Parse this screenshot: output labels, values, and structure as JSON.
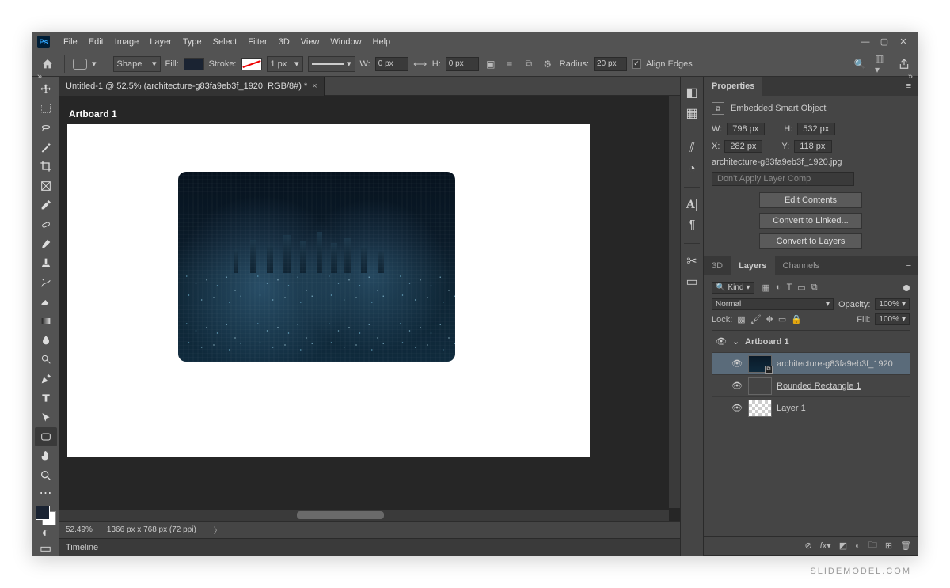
{
  "app": {
    "logo": "Ps"
  },
  "menu": [
    "File",
    "Edit",
    "Image",
    "Layer",
    "Type",
    "Select",
    "Filter",
    "3D",
    "View",
    "Window",
    "Help"
  ],
  "options": {
    "mode": "Shape",
    "fill_label": "Fill:",
    "stroke_label": "Stroke:",
    "stroke_width": "1 px",
    "w_label": "W:",
    "w_value": "0 px",
    "h_label": "H:",
    "h_value": "0 px",
    "radius_label": "Radius:",
    "radius_value": "20 px",
    "align_edges_label": "Align Edges",
    "link_glyph": "⟷"
  },
  "document": {
    "tab_title": "Untitled-1 @ 52.5% (architecture-g83fa9eb3f_1920, RGB/8#) *",
    "artboard_label": "Artboard 1",
    "zoom": "52.49%",
    "dims": "1366 px x 768 px (72 ppi)"
  },
  "timeline": {
    "label": "Timeline"
  },
  "properties": {
    "tab": "Properties",
    "type_label": "Embedded Smart Object",
    "w_label": "W:",
    "w_value": "798 px",
    "h_label": "H:",
    "h_value": "532 px",
    "x_label": "X:",
    "x_value": "282 px",
    "y_label": "Y:",
    "y_value": "118 px",
    "filename": "architecture-g83fa9eb3f_1920.jpg",
    "layer_comp": "Don't Apply Layer Comp",
    "btn_edit": "Edit Contents",
    "btn_linked": "Convert to Linked...",
    "btn_layers": "Convert to Layers"
  },
  "layers_panel": {
    "tabs": [
      "3D",
      "Layers",
      "Channels"
    ],
    "active_tab": "Layers",
    "filter_kind": "Kind",
    "blend_mode": "Normal",
    "opacity_label": "Opacity:",
    "opacity_value": "100%",
    "lock_label": "Lock:",
    "fill_label": "Fill:",
    "fill_value": "100%",
    "layers": [
      {
        "name": "Artboard 1",
        "type": "artboard"
      },
      {
        "name": "architecture-g83fa9eb3f_1920",
        "type": "smartobject",
        "selected": true
      },
      {
        "name": "Rounded Rectangle 1",
        "type": "shape"
      },
      {
        "name": "Layer 1",
        "type": "raster"
      }
    ]
  },
  "watermark": "SLIDEMODEL.COM"
}
